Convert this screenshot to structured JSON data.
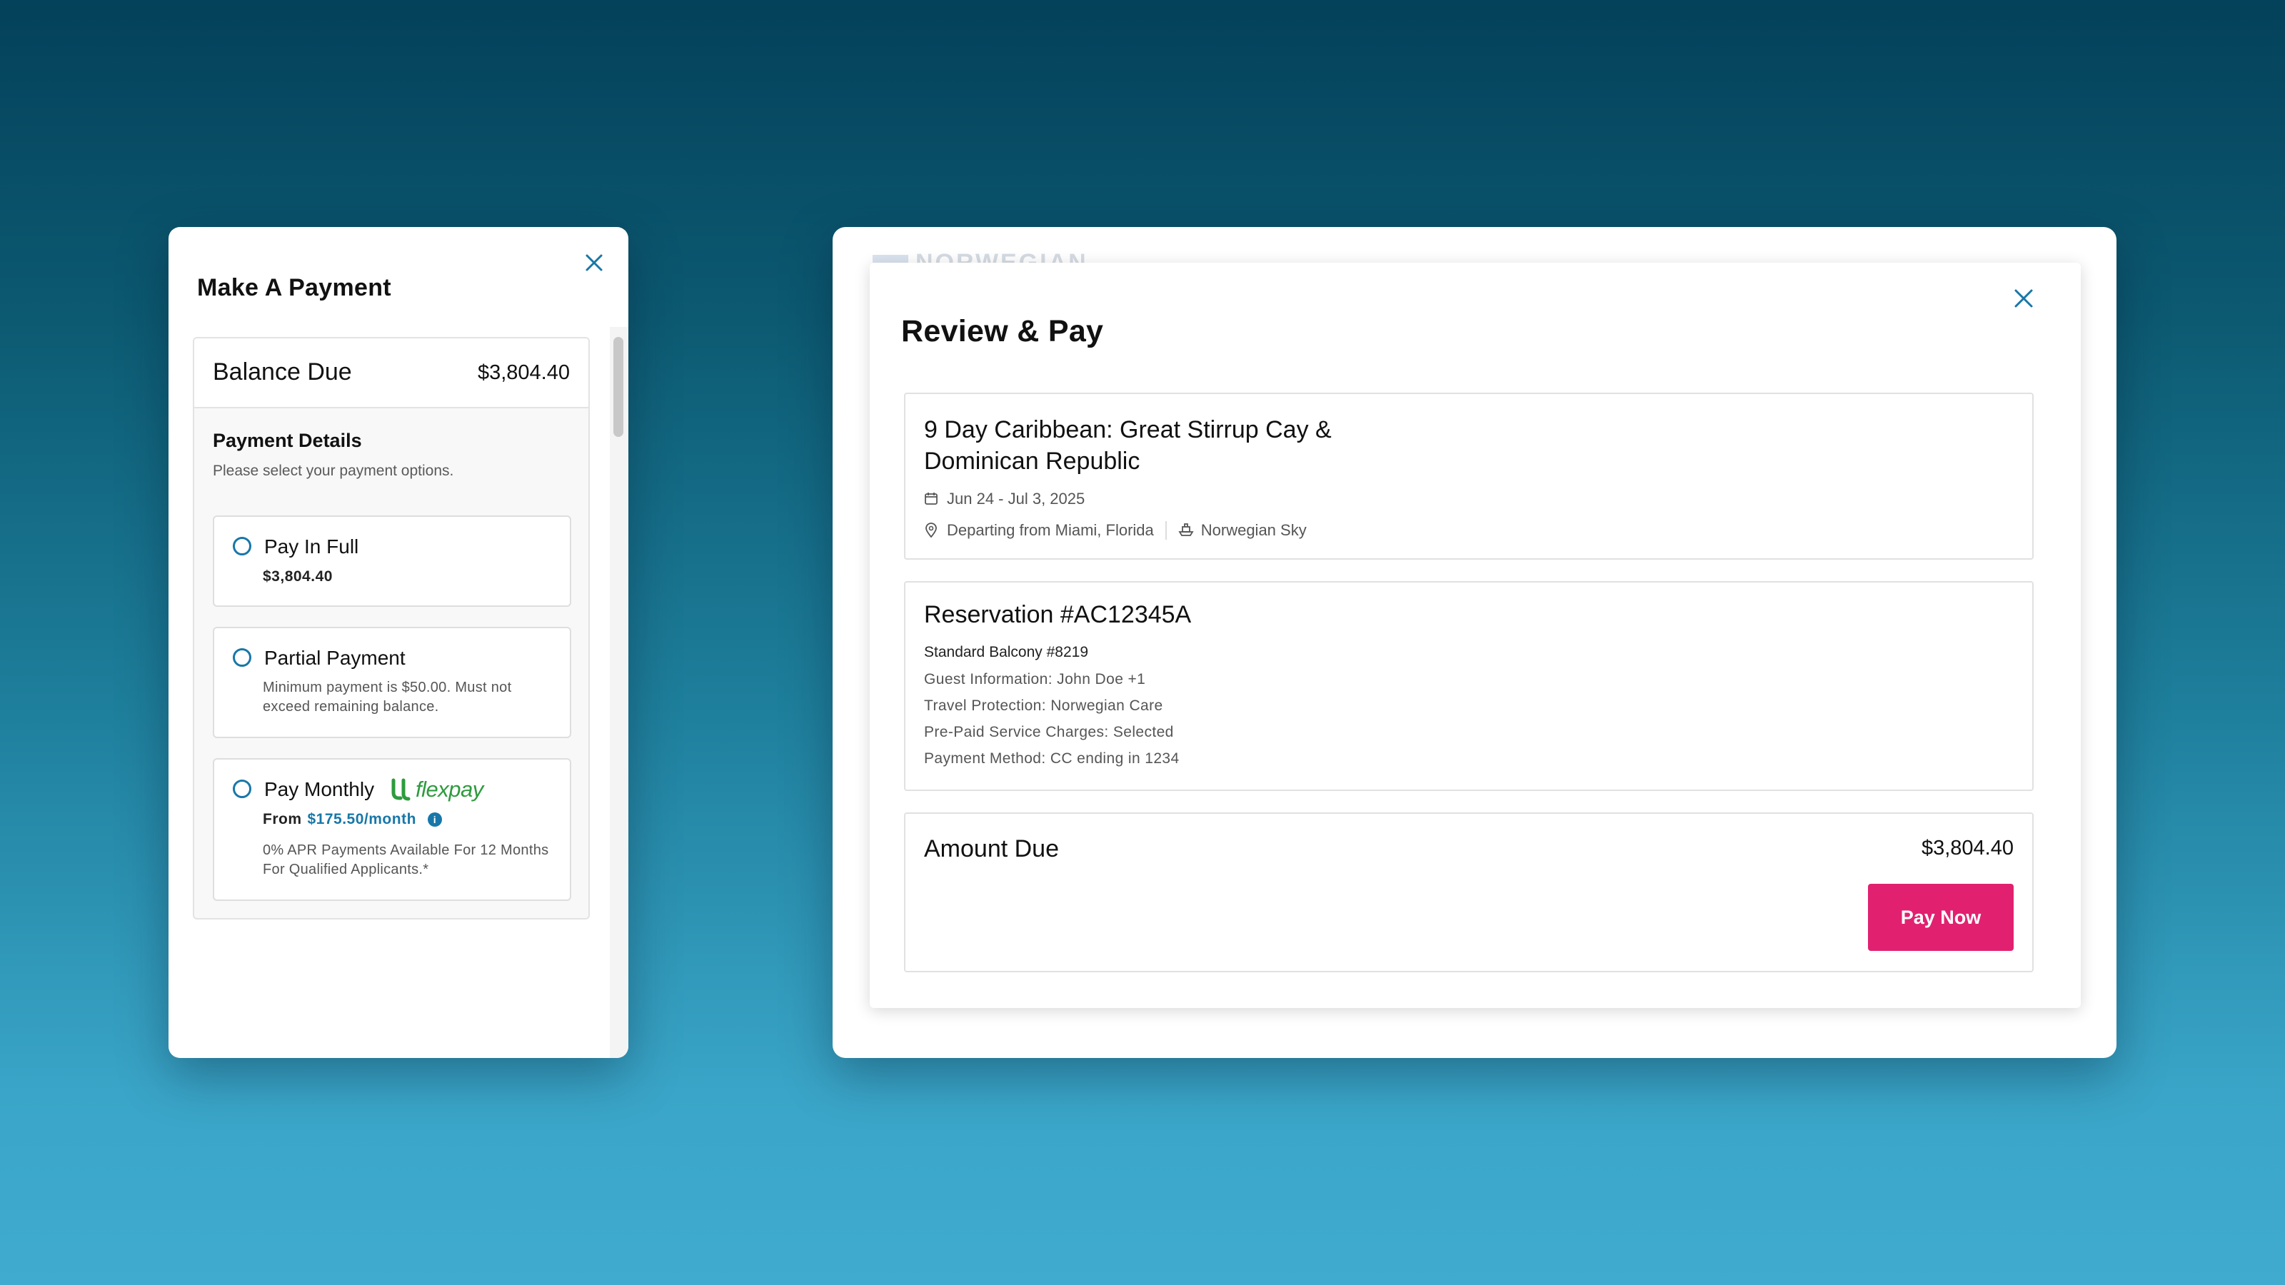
{
  "payment_modal": {
    "title": "Make A Payment",
    "balance_label": "Balance Due",
    "balance_amount": "$3,804.40",
    "details_title": "Payment Details",
    "details_subtitle": "Please select your payment options.",
    "options": [
      {
        "label": "Pay In Full",
        "amount": "$3,804.40",
        "selected": false
      },
      {
        "label": "Partial Payment",
        "note": "Minimum payment is $50.00. Must not exceed remaining balance.",
        "selected": false
      },
      {
        "label": "Pay Monthly",
        "brand": "flexpay",
        "from_label": "From",
        "from_amount": "$175.50/month",
        "note": "0% APR Payments Available For 12 Months For Qualified Applicants.*",
        "selected": false
      }
    ]
  },
  "review_modal": {
    "background_logo": "NORWEGIAN",
    "title": "Review & Pay",
    "trip": {
      "title": "9 Day Caribbean: Great Stirrup Cay & Dominican Republic",
      "dates": "Jun 24 - Jul 3, 2025",
      "departure": "Departing from Miami, Florida",
      "ship": "Norwegian Sky"
    },
    "reservation": {
      "title": "Reservation #AC12345A",
      "cabin": "Standard Balcony #8219",
      "lines": [
        "Guest Information: John Doe +1",
        "Travel Protection: Norwegian Care",
        "Pre-Paid Service Charges: Selected",
        "Payment Method: CC ending in 1234"
      ]
    },
    "amount": {
      "label": "Amount Due",
      "value": "$3,804.40",
      "button_label": "Pay Now"
    }
  },
  "colors": {
    "accent_blue": "#1877a8",
    "pay_button": "#e1216f",
    "flexpay_green": "#2e9b3e"
  },
  "icons": [
    "close-icon",
    "calendar-icon",
    "location-pin-icon",
    "ship-icon",
    "info-icon",
    "flexpay-logo-icon"
  ]
}
